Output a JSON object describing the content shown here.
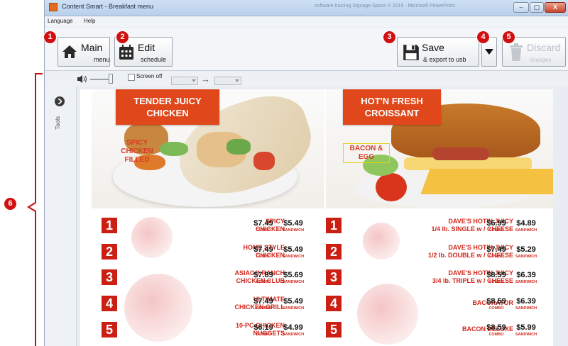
{
  "window": {
    "title": "Content Smart - Breakfast menu",
    "title_right": "software training Signage Space © 2015 - Microsoft PowerPoint",
    "controls": [
      "–",
      "▢",
      "X"
    ]
  },
  "menu": [
    "Language",
    "Help"
  ],
  "toolbar": {
    "main_label": "Main",
    "main_sub": "menu",
    "edit_label": "Edit",
    "edit_sub": "schedule",
    "save_label": "Save",
    "save_sub": "& export to usb",
    "discard_label": "Discard",
    "discard_sub": "changes"
  },
  "badges": [
    "1",
    "2",
    "3",
    "4",
    "5",
    "6"
  ],
  "controls": {
    "screen_off": "Screen off",
    "arrow": "→"
  },
  "sidebar": {
    "tools": "Tools"
  },
  "panels": {
    "left_caption": [
      "TENDER JUICY",
      "CHICKEN"
    ],
    "left_overlay": [
      "SPICY",
      "CHICKEN",
      "FILLED"
    ],
    "right_caption": [
      "HOT'N FRESH",
      "CROISSANT"
    ],
    "right_overlay": [
      "BACON &",
      "EGG"
    ]
  },
  "price_labels": {
    "combo": "COMBO",
    "sandwich": "SANDWICH"
  },
  "left_items": [
    {
      "num": "1",
      "line1": "SPICY",
      "line2": "CHICKEN",
      "combo": "$7.49",
      "sandwich": "$5.49"
    },
    {
      "num": "2",
      "line1": "HOME STYLE",
      "line2": "CHICKEN",
      "combo": "$7.49",
      "sandwich": "$5.49"
    },
    {
      "num": "3",
      "line1": "ASIAGO RANCH",
      "line2": "CHICKEN CLUB",
      "combo": "$7.89",
      "sandwich": "$5.69"
    },
    {
      "num": "4",
      "line1": "ULTIMATE",
      "line2": "CHICKEN GRILL",
      "combo": "$7.49",
      "sandwich": "$5.49"
    },
    {
      "num": "5",
      "line1": "10-PC CHICKEN",
      "line2": "NUGGETS",
      "combo": "$6.19",
      "sandwich": "$4.99"
    }
  ],
  "right_items": [
    {
      "num": "1",
      "line1": "DAVE'S HOT'N JUICY",
      "line2": "1/4 lb. SINGLE w / CHEESE",
      "combo": "$6.99",
      "sandwich": "$4.89"
    },
    {
      "num": "2",
      "line1": "DAVE'S HOT'N JUICY",
      "line2": "1/2 lb. DOUBLE w / CHEESE",
      "combo": "$7.49",
      "sandwich": "$5.29"
    },
    {
      "num": "3",
      "line1": "DAVE'S HOT'N JUICY",
      "line2": "3/4 lb. TRIPLE w / CHEESE",
      "combo": "$8.59",
      "sandwich": "$6.39"
    },
    {
      "num": "4",
      "line1": "",
      "line2": "BACORATOR",
      "combo": "$8.59",
      "sandwich": "$6.39"
    },
    {
      "num": "5",
      "line1": "",
      "line2": "BACON DELUXE",
      "combo": "$8.59",
      "sandwich": "$5.99"
    }
  ],
  "colors": {
    "accent_red": "#d10f0f",
    "caption_orange": "#e0471b",
    "price_red": "#d2261b"
  }
}
